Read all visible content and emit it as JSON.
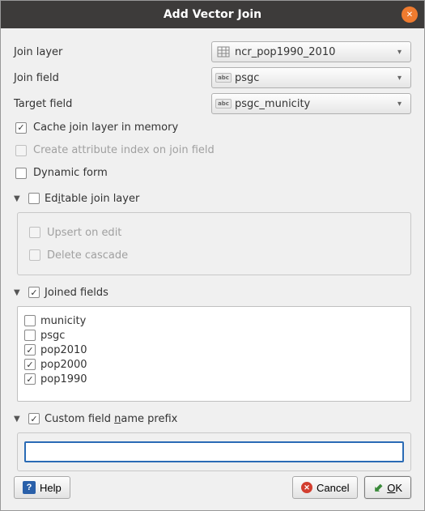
{
  "title": "Add Vector Join",
  "labels": {
    "join_layer": "Join layer",
    "join_field": "Join field",
    "target_field": "Target field"
  },
  "combos": {
    "join_layer": "ncr_pop1990_2010",
    "join_field": "psgc",
    "target_field": "psgc_municity"
  },
  "options": {
    "cache": "Cache join layer in memory",
    "create_index": "Create attribute index on join field",
    "dynamic_form": "Dynamic form",
    "editable": "Editable join layer",
    "upsert": "Upsert on edit",
    "delete_cascade": "Delete cascade",
    "joined_fields": "Joined fields",
    "custom_prefix": "Custom field name prefix"
  },
  "fields": [
    {
      "name": "municity",
      "checked": false
    },
    {
      "name": "psgc",
      "checked": false
    },
    {
      "name": "pop2010",
      "checked": true
    },
    {
      "name": "pop2000",
      "checked": true
    },
    {
      "name": "pop1990",
      "checked": true
    }
  ],
  "prefix_value": "",
  "buttons": {
    "help": "Help",
    "cancel": "Cancel",
    "ok": "OK"
  }
}
